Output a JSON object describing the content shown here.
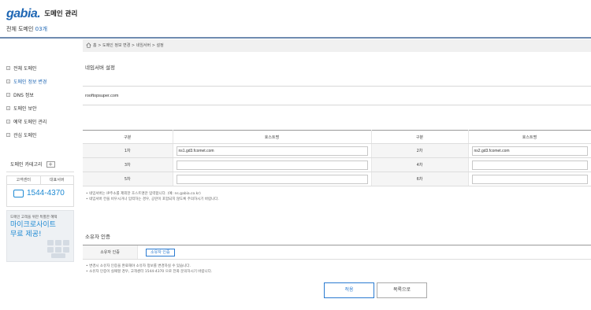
{
  "header": {
    "logo": "gabia.",
    "title": "도메인 관리",
    "count_prefix": "전체 도메인 ",
    "count_value": "03개"
  },
  "breadcrumb": {
    "text": "홈 > 도메인 정보 변경 > 네임서버 > 설정"
  },
  "sidebar": {
    "items": [
      {
        "label": "전체 도메인"
      },
      {
        "label": "도메인 정보 변경"
      },
      {
        "label": "DNS 정보"
      },
      {
        "label": "도메인 보안"
      },
      {
        "label": "예약 도메인 관리"
      },
      {
        "label": "관심 도메인"
      }
    ],
    "category_label": "도메인 카테고리",
    "category_button": "+",
    "support_tabs": [
      "고객센터",
      "대표서버"
    ],
    "phone": "1544-4370",
    "banner_small": "도메인 고객을 위한 특별한 혜택",
    "banner_line1": "마이크로사이트",
    "banner_line2": "무료 제공!"
  },
  "main": {
    "section_title": "네임서버 설정",
    "domain_name": "rooftopsuper.com",
    "table": {
      "col_label": "구분",
      "col_host": "호스트명",
      "rows": [
        {
          "left_label": "1차",
          "left_value": "ns1.gd3.fcomet.com",
          "right_label": "2차",
          "right_value": "ns2.gd3.fcomet.com"
        },
        {
          "left_label": "3차",
          "left_value": "",
          "right_label": "4차",
          "right_value": ""
        },
        {
          "left_label": "5차",
          "left_value": "",
          "right_label": "6차",
          "right_value": ""
        }
      ]
    },
    "notes": [
      "• 네임서버는 IP주소를 제외한 호스트명만 입력합니다. (예: ns.gabia.co.kr)",
      "• 네임서버 칸을 비우시거나 입력하는 경우, 공란이 포함되지 않도록 주의하시기 바랍니다."
    ],
    "owner_title": "소유자 인증",
    "owner_label": "소유자 인증",
    "owner_button": "소유자 인증",
    "owner_notes": [
      "• 변경시 소유자 인증을 완료해야 소유자 정보를 변경하실 수 있습니다.",
      "• 소유자 인증이 실패할 경우, 고객센터 1544-4370 으로 전화 문의하시기 바랍니다."
    ],
    "apply_button": "적용",
    "list_button": "목록으로"
  }
}
